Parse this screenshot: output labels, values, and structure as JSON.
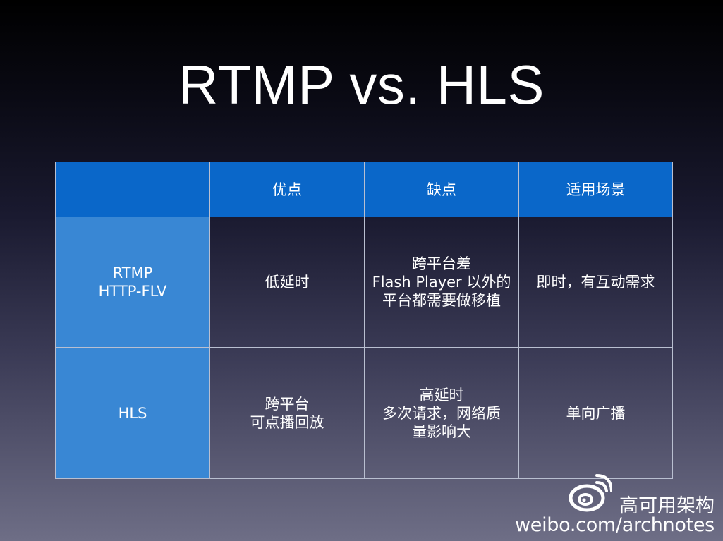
{
  "slide": {
    "title": "RTMP vs. HLS"
  },
  "table": {
    "header": {
      "corner": "",
      "pros": "优点",
      "cons": "缺点",
      "scenario": "适用场景"
    },
    "rows": [
      {
        "name_lines": [
          "RTMP",
          "HTTP-FLV"
        ],
        "pros_lines": [
          "低延时"
        ],
        "cons_lines": [
          "跨平台差",
          "Flash Player 以外的",
          "平台都需要做移植"
        ],
        "scenario_lines": [
          "即时，有互动需求"
        ]
      },
      {
        "name_lines": [
          "HLS"
        ],
        "pros_lines": [
          "跨平台",
          "可点播回放"
        ],
        "cons_lines": [
          "高延时",
          "多次请求，网络质",
          "量影响大"
        ],
        "scenario_lines": [
          "单向广播"
        ]
      }
    ]
  },
  "watermark": {
    "name": "高可用架构",
    "url": "weibo.com/archnotes",
    "logo_icon": "weibo-logo-icon"
  },
  "colors": {
    "header_blue": "#0a67c9",
    "rowhead_blue": "#3987d4",
    "text": "#ffffff"
  }
}
